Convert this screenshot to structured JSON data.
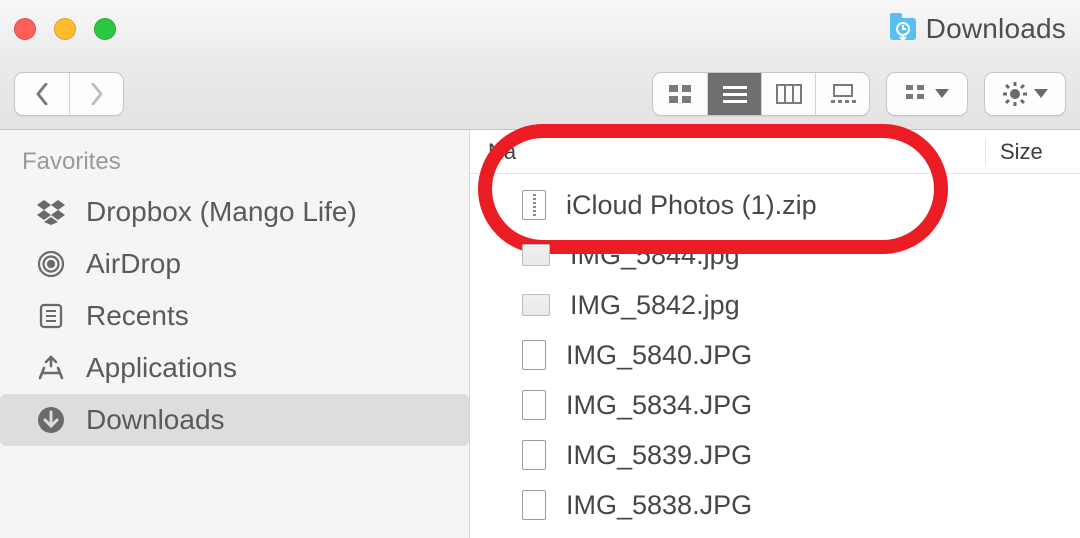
{
  "titlebar": {
    "title": "Downloads"
  },
  "toolbar": {
    "nav": {
      "back": "Back",
      "forward": "Forward"
    },
    "views": {
      "icon": "Icon view",
      "list": "List view",
      "column": "Column view",
      "gallery": "Gallery view",
      "active": "list"
    },
    "arrange": "Arrange",
    "action": "Action"
  },
  "sidebar": {
    "header": "Favorites",
    "items": [
      {
        "icon": "dropbox",
        "label": "Dropbox (Mango Life)"
      },
      {
        "icon": "airdrop",
        "label": "AirDrop"
      },
      {
        "icon": "recents",
        "label": "Recents"
      },
      {
        "icon": "applications",
        "label": "Applications"
      },
      {
        "icon": "downloads",
        "label": "Downloads",
        "selected": true
      }
    ]
  },
  "columns": {
    "name": "Name",
    "name_visible_fragment": "Na",
    "size": "Size"
  },
  "files": [
    {
      "type": "zip",
      "name": "iCloud Photos (1).zip"
    },
    {
      "type": "img",
      "name": "IMG_5844.jpg"
    },
    {
      "type": "img",
      "name": "IMG_5842.jpg"
    },
    {
      "type": "doc",
      "name": "IMG_5840.JPG"
    },
    {
      "type": "doc",
      "name": "IMG_5834.JPG"
    },
    {
      "type": "doc",
      "name": "IMG_5839.JPG"
    },
    {
      "type": "doc",
      "name": "IMG_5838.JPG"
    }
  ],
  "annotation": {
    "ring_target_indices": [
      0,
      1
    ]
  }
}
